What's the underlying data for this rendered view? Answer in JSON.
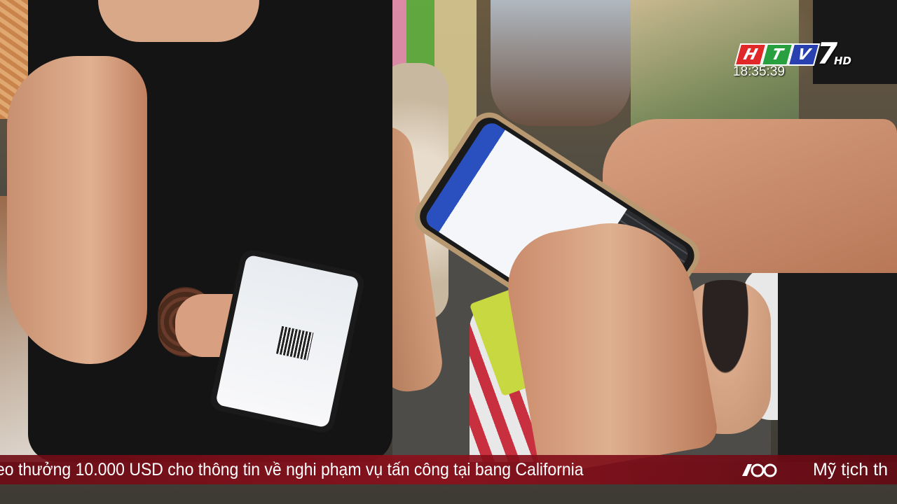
{
  "channel": {
    "logo_letters": [
      "H",
      "T",
      "V"
    ],
    "logo_number": "7",
    "logo_suffix": "HD",
    "clock": "18:35:39",
    "brand_colors": {
      "h": "#e02828",
      "t": "#28a040",
      "v": "#2840b0"
    }
  },
  "ticker": {
    "headline": "eo thưởng 10.000 USD cho thông tin về nghi phạm vụ tấn công tại bang California",
    "next_headline": "Mỹ tịch th",
    "separator_icon": "60s-logo-icon",
    "background_color": "#8c101c"
  }
}
